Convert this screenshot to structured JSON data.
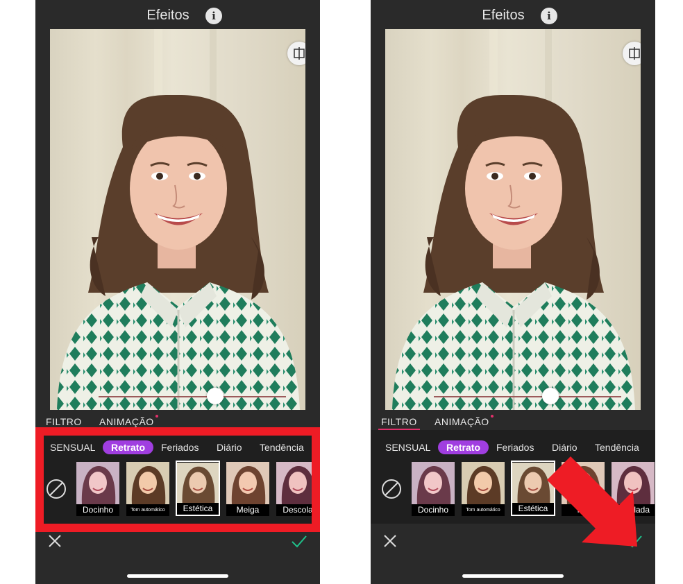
{
  "colors": {
    "accent_pill": "#a03ee0",
    "tab_indicator": "#e0306a",
    "apply_check": "#1fc08a",
    "highlight_red": "#ee1c25"
  },
  "screens": [
    {
      "header": {
        "title": "Efeitos",
        "info_icon": "info-icon"
      },
      "slider": {
        "value": 0.75
      },
      "tabs": [
        {
          "label": "FILTRO",
          "active": false
        },
        {
          "label": "ANIMAÇÃO",
          "badge": true
        }
      ],
      "categories": [
        "SENSUAL",
        "Retrato",
        "Feriados",
        "Diário",
        "Tendência"
      ],
      "active_category": "Retrato",
      "filters": [
        {
          "label": "Docinho"
        },
        {
          "label": "Tom automático"
        },
        {
          "label": "Estética",
          "selected": true
        },
        {
          "label": "Meiga"
        },
        {
          "label": "Descola"
        }
      ],
      "actions": {
        "cancel_icon": "close-icon",
        "apply_icon": "check-icon"
      }
    },
    {
      "header": {
        "title": "Efeitos",
        "info_icon": "info-icon"
      },
      "slider": {
        "value": 0.75
      },
      "tabs": [
        {
          "label": "FILTRO",
          "active": true
        },
        {
          "label": "ANIMAÇÃO",
          "badge": true
        }
      ],
      "categories": [
        "SENSUAL",
        "Retrato",
        "Feriados",
        "Diário",
        "Tendência"
      ],
      "active_category": "Retrato",
      "filters": [
        {
          "label": "Docinho"
        },
        {
          "label": "Tom automático"
        },
        {
          "label": "Estética",
          "selected": true
        },
        {
          "label": "Me"
        },
        {
          "label": "escolada"
        }
      ],
      "actions": {
        "cancel_icon": "close-icon",
        "apply_icon": "check-icon"
      }
    }
  ],
  "annotations": {
    "left_highlight": "red-rectangle around filter panel",
    "right_pointer": "red arrow pointing to apply button"
  }
}
